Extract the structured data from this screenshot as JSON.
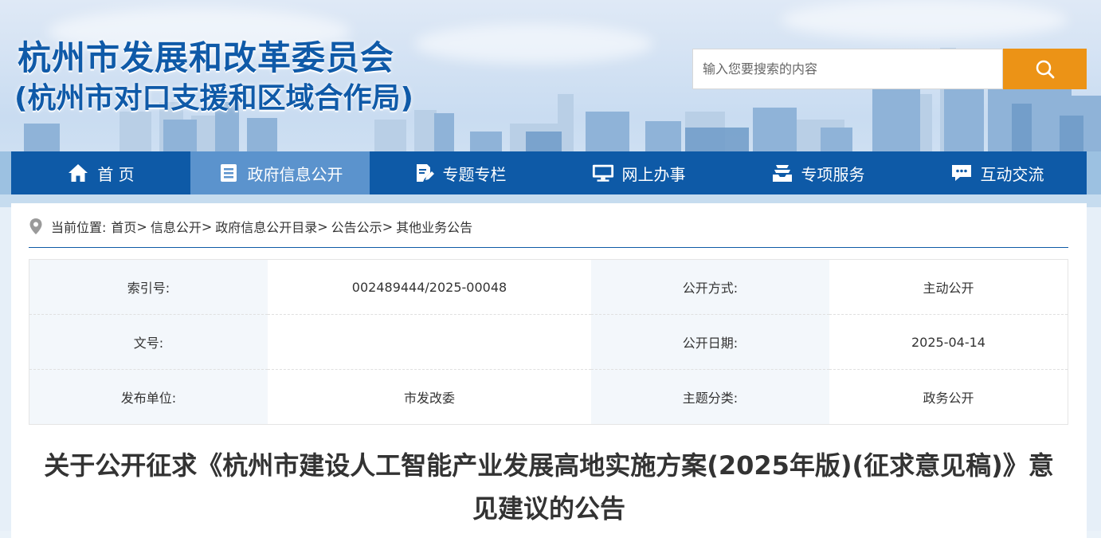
{
  "header": {
    "title_line1": "杭州市发展和改革委员会",
    "title_line2": "(杭州市对口支援和区域合作局)"
  },
  "search": {
    "placeholder": "输入您要搜索的内容",
    "button_icon": "search-icon",
    "accent": "#ec9316"
  },
  "nav": {
    "items": [
      {
        "label": "首 页",
        "icon": "home-icon"
      },
      {
        "label": "政府信息公开",
        "icon": "document-list-icon"
      },
      {
        "label": "专题专栏",
        "icon": "edit-document-icon"
      },
      {
        "label": "网上办事",
        "icon": "monitor-icon"
      },
      {
        "label": "专项服务",
        "icon": "tray-icon"
      },
      {
        "label": "互动交流",
        "icon": "chat-icon"
      }
    ],
    "active_index": 1,
    "bg": "#0e5aa7",
    "active_bg": "#5b93cd"
  },
  "breadcrumb": {
    "prefix": "当前位置:",
    "items": [
      "首页",
      "信息公开",
      "政府信息公开目录",
      "公告公示",
      "其他业务公告"
    ],
    "separator": ">"
  },
  "meta": {
    "rows": [
      {
        "l1": "索引号:",
        "v1": "002489444/2025-00048",
        "l2": "公开方式:",
        "v2": "主动公开"
      },
      {
        "l1": "文号:",
        "v1": "",
        "l2": "公开日期:",
        "v2": "2025-04-14"
      },
      {
        "l1": "发布单位:",
        "v1": "市发改委",
        "l2": "主题分类:",
        "v2": "政务公开"
      }
    ]
  },
  "article": {
    "title": "关于公开征求《杭州市建设人工智能产业发展高地实施方案(2025年版)(征求意见稿)》意见建议的公告"
  }
}
